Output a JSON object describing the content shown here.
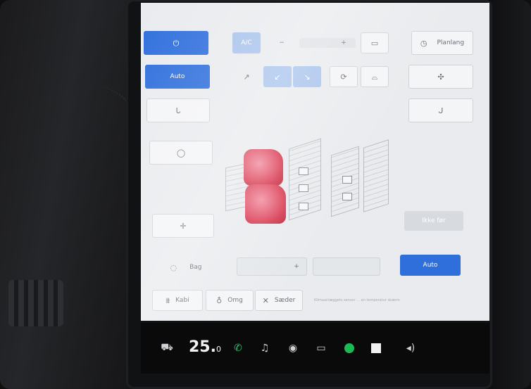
{
  "climate": {
    "row1": {
      "ac_label": "A/C",
      "fan_minus": "−",
      "fan_plus": "+",
      "schedule_label": "Planlang"
    },
    "auto_label": "Auto",
    "recirc_label": "Ikke før",
    "bottom_auto_label": "Auto",
    "left_temp_label": "Bag",
    "bottom_tabs": [
      {
        "label": "Kabi"
      },
      {
        "label": "Omg"
      },
      {
        "label": "Sæder"
      }
    ],
    "status_text": "Klimaanlæggets sensor ... en temperatur skærm"
  },
  "taskbar": {
    "temperature_main": "25.",
    "temperature_decimal": "0"
  },
  "colors": {
    "accent": "#2f6fdc",
    "seat": "#d8384f",
    "spotify": "#1db954",
    "phone": "#2ecc71"
  }
}
